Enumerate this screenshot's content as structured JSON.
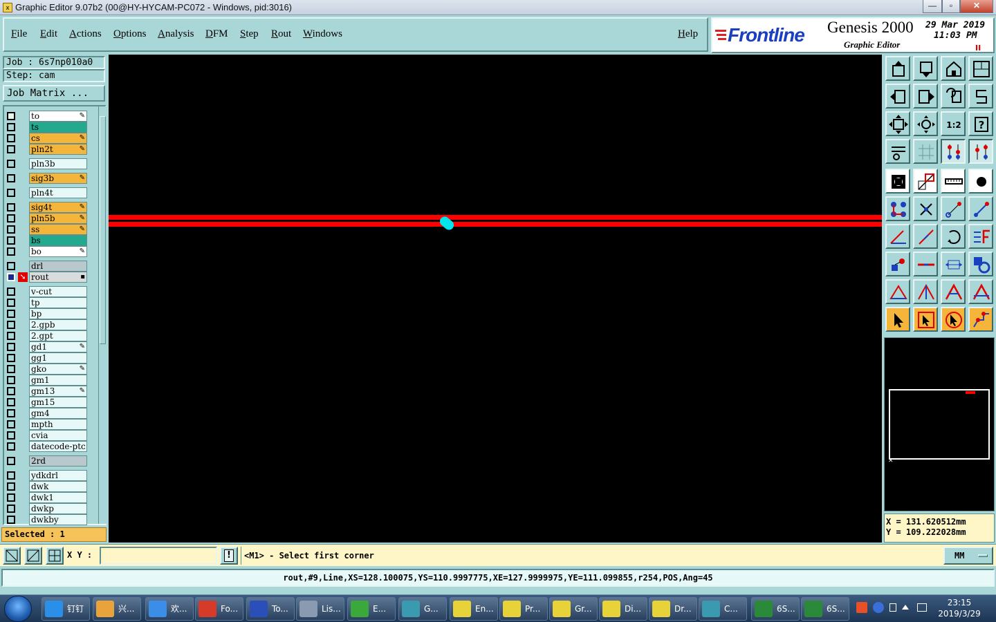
{
  "window": {
    "title": "Graphic Editor 9.07b2 (00@HY-HYCAM-PC072 - Windows, pid:3016)",
    "app_icon_glyph": "x",
    "min_glyph": "—",
    "max_glyph": "▫",
    "close_glyph": "✕"
  },
  "menu": [
    "File",
    "Edit",
    "Actions",
    "Options",
    "Analysis",
    "DFM",
    "Step",
    "Rout",
    "Windows"
  ],
  "help_label": "Help",
  "brand": {
    "logo": "Frontline",
    "product": "Genesis 2000",
    "subtitle": "Graphic Editor",
    "date": "29 Mar 2019",
    "time": "11:03 PM",
    "pause": "II"
  },
  "job": {
    "job_line": "Job : 6s7np010a0",
    "step_line": "Step: cam"
  },
  "job_matrix_label": "Job Matrix ...",
  "layers": [
    {
      "name": "to",
      "color": "#ffffff",
      "mark": "✎",
      "group": 1,
      "checked": true
    },
    {
      "name": "ts",
      "color": "#22a98e",
      "mark": "",
      "group": 1,
      "checked": false
    },
    {
      "name": "cs",
      "color": "#f5b53a",
      "mark": "✎",
      "group": 1,
      "checked": false
    },
    {
      "name": "pln2t",
      "color": "#f5b53a",
      "mark": "✎",
      "group": 1,
      "checked": false
    },
    {
      "name": "pln3b",
      "color": "#e6f8f8",
      "mark": "",
      "group": 2,
      "checked": false
    },
    {
      "name": "sig3b",
      "color": "#f5b53a",
      "mark": "✎",
      "group": 3,
      "checked": false
    },
    {
      "name": "pln4t",
      "color": "#e6f8f8",
      "mark": "",
      "group": 4,
      "checked": false
    },
    {
      "name": "sig4t",
      "color": "#f5b53a",
      "mark": "✎",
      "group": 5,
      "checked": false
    },
    {
      "name": "pln5b",
      "color": "#f5b53a",
      "mark": "✎",
      "group": 5,
      "checked": false
    },
    {
      "name": "ss",
      "color": "#f5b53a",
      "mark": "✎",
      "group": 5,
      "checked": false
    },
    {
      "name": "bs",
      "color": "#22a98e",
      "mark": "",
      "group": 5,
      "checked": false
    },
    {
      "name": "bo",
      "color": "#ffffff",
      "mark": "✎",
      "group": 5,
      "checked": false
    },
    {
      "name": "drl",
      "color": "#b8c8cc",
      "mark": "",
      "group": 6,
      "checked": false
    },
    {
      "name": "rout",
      "color": "#d8dcdc",
      "mark": "▪",
      "group": 6,
      "checked": true,
      "active": true
    },
    {
      "name": "v-cut",
      "color": "#e6f8f8",
      "mark": "",
      "group": 7,
      "checked": false
    },
    {
      "name": "tp",
      "color": "#e6f8f8",
      "mark": "",
      "group": 7,
      "checked": false
    },
    {
      "name": "bp",
      "color": "#e6f8f8",
      "mark": "",
      "group": 7,
      "checked": false
    },
    {
      "name": "2.gpb",
      "color": "#e6f8f8",
      "mark": "",
      "group": 7,
      "checked": false
    },
    {
      "name": "2.gpt",
      "color": "#e6f8f8",
      "mark": "",
      "group": 7,
      "checked": false
    },
    {
      "name": "gd1",
      "color": "#e6f8f8",
      "mark": "✎",
      "group": 7,
      "checked": false
    },
    {
      "name": "gg1",
      "color": "#e6f8f8",
      "mark": "",
      "group": 7,
      "checked": false
    },
    {
      "name": "gko",
      "color": "#e6f8f8",
      "mark": "✎",
      "group": 7,
      "checked": false
    },
    {
      "name": "gm1",
      "color": "#e6f8f8",
      "mark": "",
      "group": 7,
      "checked": false
    },
    {
      "name": "gm13",
      "color": "#e6f8f8",
      "mark": "✎",
      "group": 7,
      "checked": false
    },
    {
      "name": "gm15",
      "color": "#e6f8f8",
      "mark": "",
      "group": 7,
      "checked": false
    },
    {
      "name": "gm4",
      "color": "#e6f8f8",
      "mark": "",
      "group": 7,
      "checked": false
    },
    {
      "name": "mpth",
      "color": "#e6f8f8",
      "mark": "",
      "group": 7,
      "checked": false
    },
    {
      "name": "cvia",
      "color": "#e6f8f8",
      "mark": "",
      "group": 7,
      "checked": false
    },
    {
      "name": "datecode-ptc",
      "color": "#e6f8f8",
      "mark": "",
      "group": 7,
      "checked": false
    },
    {
      "name": "2rd",
      "color": "#b8c8cc",
      "mark": "",
      "group": 8,
      "checked": false
    },
    {
      "name": "ydkdrl",
      "color": "#e6f8f8",
      "mark": "",
      "group": 9,
      "checked": false
    },
    {
      "name": "dwk",
      "color": "#e6f8f8",
      "mark": "",
      "group": 9,
      "checked": false
    },
    {
      "name": "dwk1",
      "color": "#e6f8f8",
      "mark": "",
      "group": 9,
      "checked": false
    },
    {
      "name": "dwkp",
      "color": "#e6f8f8",
      "mark": "",
      "group": 9,
      "checked": false
    },
    {
      "name": "dwkby",
      "color": "#e6f8f8",
      "mark": "",
      "group": 9,
      "checked": false
    }
  ],
  "selected_label": "Selected : 1",
  "canvas": {
    "feature_color": "#ff0000",
    "highlight_color": "#00e5ee",
    "background": "#000000"
  },
  "tools": [
    "export-icon",
    "import-icon",
    "home-icon",
    "panel-icon",
    "pan-left-icon",
    "pan-right-icon",
    "undo-view-icon",
    "redraw-icon",
    "zoom-fit-icon",
    "zoom-center-icon",
    "zoom-1to2-icon",
    "help-icon",
    "snap-settings-icon",
    "grid-icon",
    "layer-features-icon",
    "layer-features-alt-icon",
    "select-icon",
    "area-select-icon",
    "ruler-icon",
    "pad-icon",
    "connect-icon",
    "delete-icon",
    "move-node-icon",
    "move-node-alt-icon",
    "line-angle-icon",
    "line-icon",
    "arc-icon",
    "text-f-icon",
    "copy-icon",
    "line-horiz-icon",
    "measure-icon",
    "shapes-icon",
    "triangle-a-icon",
    "triangle-b-icon",
    "triangle-c-icon",
    "triangle-d-icon",
    "pointer-icon",
    "pointer-box-icon",
    "pointer-circle-icon",
    "route-icon"
  ],
  "tool_zoom_label": "1:2",
  "tool_help_label": "?",
  "coords": {
    "x_line": "X = 131.620512mm",
    "y_line": "Y = 109.222028mm"
  },
  "cmd": {
    "xy_label": "X Y :",
    "xy_value": "",
    "warn_glyph": "!",
    "prompt": "<M1> - Select first corner",
    "units": "MM"
  },
  "status": "rout,#9,Line,XS=128.100075,YS=110.9997775,XE=127.9999975,YE=111.099855,r254,POS,Ang=45",
  "taskbar": {
    "items": [
      {
        "label": "钉钉",
        "color": "#2a8fe8"
      },
      {
        "label": "兴...",
        "color": "#e8a43a"
      },
      {
        "label": "欢...",
        "color": "#3a8ee8"
      },
      {
        "label": "Fo...",
        "color": "#d63b2a"
      },
      {
        "label": "To...",
        "color": "#2a4fb8"
      },
      {
        "label": "Lis...",
        "color": "#8a9ab0"
      },
      {
        "label": "E...",
        "color": "#3aa83a"
      },
      {
        "label": "G...",
        "color": "#3a9ab0"
      },
      {
        "label": "En...",
        "color": "#e8d23a"
      },
      {
        "label": "Pr...",
        "color": "#e8d23a"
      },
      {
        "label": "Gr...",
        "color": "#e8d23a"
      },
      {
        "label": "Di...",
        "color": "#e8d23a"
      },
      {
        "label": "Dr...",
        "color": "#e8d23a"
      },
      {
        "label": "C...",
        "color": "#3a9ab0"
      },
      {
        "label": "6S...",
        "color": "#2a8a3a"
      },
      {
        "label": "6S...",
        "color": "#2a8a3a"
      }
    ],
    "time": "23:15",
    "date": "2019/3/29"
  }
}
